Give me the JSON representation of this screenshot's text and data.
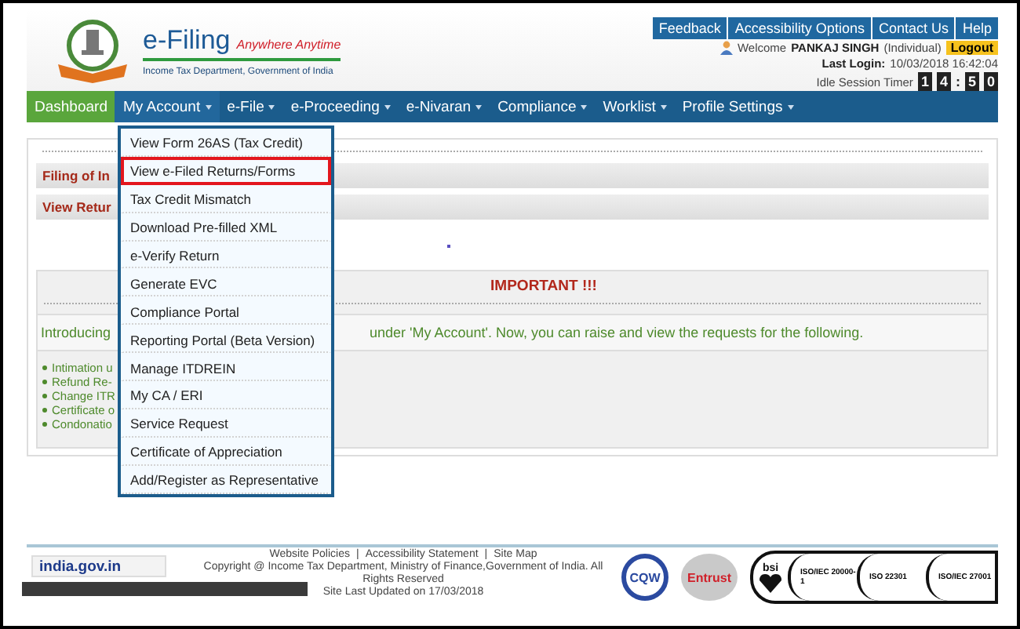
{
  "header": {
    "brand": "e-Filing",
    "tagline": "Anywhere Anytime",
    "department": "Income Tax Department, Government of India",
    "top_links": [
      "Feedback",
      "Accessibility Options",
      "Contact Us",
      "Help"
    ],
    "welcome": "Welcome",
    "user_name": "PANKAJ SINGH",
    "user_type": "(Individual)",
    "logout": "Logout",
    "last_login_label": "Last Login:",
    "last_login": "10/03/2018 16:42:04",
    "idle_label": "Idle Session Timer",
    "timer": [
      {
        "text": "1",
        "kind": "digit"
      },
      {
        "text": "4",
        "kind": "digit"
      },
      {
        "text": ":",
        "kind": "sep"
      },
      {
        "text": "5",
        "kind": "digit"
      },
      {
        "text": "0",
        "kind": "digit"
      }
    ]
  },
  "nav": [
    {
      "label": "Dashboard",
      "home": true,
      "has_dropdown": false,
      "selected": false
    },
    {
      "label": "My Account",
      "home": false,
      "has_dropdown": true,
      "selected": true
    },
    {
      "label": "e-File",
      "home": false,
      "has_dropdown": true,
      "selected": false
    },
    {
      "label": "e-Proceeding",
      "home": false,
      "has_dropdown": true,
      "selected": false
    },
    {
      "label": "e-Nivaran",
      "home": false,
      "has_dropdown": true,
      "selected": false
    },
    {
      "label": "Compliance",
      "home": false,
      "has_dropdown": true,
      "selected": false
    },
    {
      "label": "Worklist",
      "home": false,
      "has_dropdown": true,
      "selected": false
    },
    {
      "label": "Profile Settings",
      "home": false,
      "has_dropdown": true,
      "selected": false
    }
  ],
  "dropdown": [
    {
      "label": "View Form 26AS (Tax Credit)",
      "selected": false
    },
    {
      "label": "View e-Filed Returns/Forms",
      "selected": true
    },
    {
      "label": "Tax Credit Mismatch",
      "selected": false
    },
    {
      "label": "Download Pre-filled XML",
      "selected": false
    },
    {
      "label": "e-Verify Return",
      "selected": false
    },
    {
      "label": "Generate EVC",
      "selected": false
    },
    {
      "label": "Compliance Portal",
      "selected": false
    },
    {
      "label": "Reporting Portal (Beta Version)",
      "selected": false
    },
    {
      "label": "Manage ITDREIN",
      "selected": false
    },
    {
      "label": "My CA / ERI",
      "selected": false
    },
    {
      "label": "Service Request",
      "selected": false
    },
    {
      "label": "Certificate of Appreciation",
      "selected": false
    },
    {
      "label": "Add/Register as Representative",
      "selected": false
    }
  ],
  "content": {
    "sections": [
      "Filing of In",
      "View Retur"
    ],
    "important": {
      "title": "IMPORTANT !!!",
      "intro_start": "Introducing",
      "intro_end": "under 'My Account'. Now, you can raise and view the requests for the following.",
      "items": [
        "Intimation u",
        "Refund Re-",
        "Change ITR",
        "Certificate o",
        "Condonatio"
      ]
    }
  },
  "footer": {
    "links": [
      "Website Policies",
      "Accessibility Statement",
      "Site Map"
    ],
    "separator": "|",
    "copyright": "Copyright @ Income Tax Department, Ministry of Finance,Government of India. All Rights Reserved",
    "updated": "Site Last Updated on 17/03/2018",
    "india_logo": "india.gov.in",
    "badges": [
      {
        "kind": "cqw",
        "text": "CQW"
      },
      {
        "kind": "entrust",
        "text": "Entrust"
      },
      {
        "kind": "bsi",
        "text": "bsi"
      },
      {
        "kind": "iso",
        "text": "ISO/IEC 20000-1"
      },
      {
        "kind": "iso",
        "text": "ISO 22301"
      },
      {
        "kind": "iso",
        "text": "ISO/IEC 27001"
      }
    ]
  }
}
